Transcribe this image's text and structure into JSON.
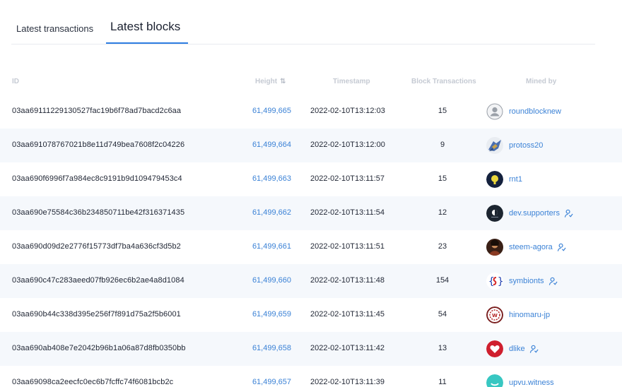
{
  "tabs": {
    "transactions_label": "Latest transactions",
    "blocks_label": "Latest blocks"
  },
  "table": {
    "headers": {
      "id": "ID",
      "height": "Height",
      "timestamp": "Timestamp",
      "block_transactions": "Block Transactions",
      "mined_by": "Mined by"
    },
    "rows": [
      {
        "id": "03aa69111229130527fac19b6f78ad7bacd2c6aa",
        "height": "61,499,665",
        "timestamp": "2022-02-10T13:12:03",
        "tx_count": "15",
        "miner": "roundblocknew",
        "avatar": "default-user-icon",
        "proxy": false
      },
      {
        "id": "03aa691078767021b8e11d749bea7608f2c04226",
        "height": "61,499,664",
        "timestamp": "2022-02-10T13:12:00",
        "tx_count": "9",
        "miner": "protoss20",
        "avatar": "protoss-avatar",
        "proxy": false
      },
      {
        "id": "03aa690f6996f7a984ec8c9191b9d109479453c4",
        "height": "61,499,663",
        "timestamp": "2022-02-10T13:11:57",
        "tx_count": "15",
        "miner": "rnt1",
        "avatar": "rnt1-avatar",
        "proxy": false
      },
      {
        "id": "03aa690e75584c36b234850711be42f316371435",
        "height": "61,499,662",
        "timestamp": "2022-02-10T13:11:54",
        "tx_count": "12",
        "miner": "dev.supporters",
        "avatar": "dev-supporters-avatar",
        "proxy": true
      },
      {
        "id": "03aa690d09d2e2776f15773df7ba4a636cf3d5b2",
        "height": "61,499,661",
        "timestamp": "2022-02-10T13:11:51",
        "tx_count": "23",
        "miner": "steem-agora",
        "avatar": "steem-agora-avatar",
        "proxy": true
      },
      {
        "id": "03aa690c47c283aeed07fb926ec6b2ae4a8d1084",
        "height": "61,499,660",
        "timestamp": "2022-02-10T13:11:48",
        "tx_count": "154",
        "miner": "symbionts",
        "avatar": "symbionts-avatar",
        "proxy": true
      },
      {
        "id": "03aa690b44c338d395e256f7f891d75a2f5b6001",
        "height": "61,499,659",
        "timestamp": "2022-02-10T13:11:45",
        "tx_count": "54",
        "miner": "hinomaru-jp",
        "avatar": "hinomaru-avatar",
        "proxy": false
      },
      {
        "id": "03aa690ab408e7e2042b96b1a06a87d8fb0350bb",
        "height": "61,499,658",
        "timestamp": "2022-02-10T13:11:42",
        "tx_count": "13",
        "miner": "dlike",
        "avatar": "dlike-avatar",
        "proxy": true
      },
      {
        "id": "03aa69098ca2eecfc0ec6b7fcffc74f6081bcb2c",
        "height": "61,499,657",
        "timestamp": "2022-02-10T13:11:39",
        "tx_count": "11",
        "miner": "upvu.witness",
        "avatar": "upvu-avatar",
        "proxy": false
      }
    ]
  },
  "colors": {
    "accent": "#2e7de1",
    "link": "#3b82d6",
    "row_alt": "#f5f8fc"
  }
}
